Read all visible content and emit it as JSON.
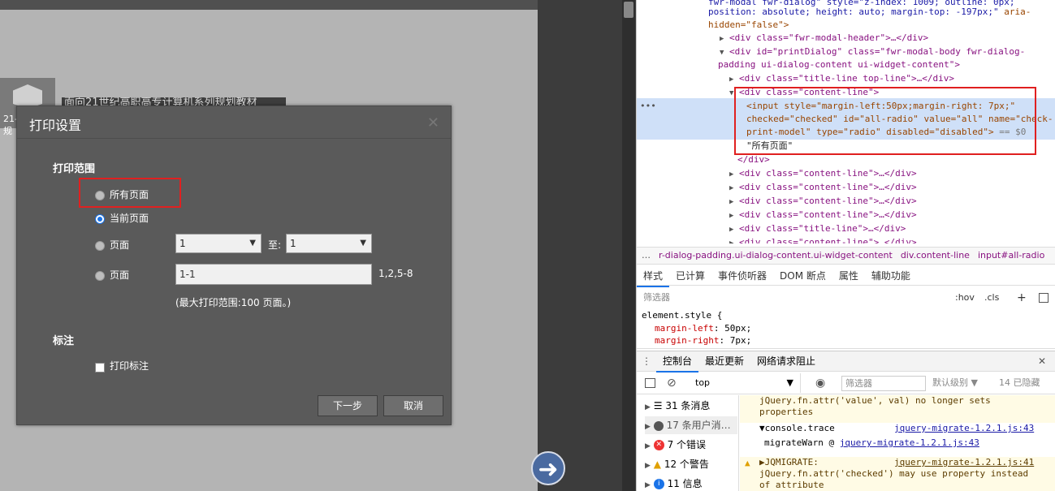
{
  "viewer": {
    "thumb_label": "21-",
    "thumb_label2": "规",
    "doc_title": "面向21世纪高职高专计算机系列规划教材",
    "back_icon": "arrow-left-icon"
  },
  "dialog": {
    "title": "打印设置",
    "close_icon": "close-icon",
    "range_section": "打印范围",
    "options": {
      "all_pages": "所有页面",
      "current_page": "当前页面",
      "page_range": "页面",
      "page_custom": "页面"
    },
    "from_value": "1",
    "to_label": "至:",
    "to_value": "1",
    "custom_value": "1-1",
    "custom_example": "1,2,5-8",
    "max_hint": "(最大打印范围:100 页面。)",
    "annot_section": "标注",
    "print_annot": "打印标注",
    "next_button": "下一步",
    "cancel_button": "取消"
  },
  "devtools": {
    "code_lines": {
      "l0": "fwr-modal fwr-dialog\" style=\"z-index: 1009; outline: 0px;",
      "l1a": "position: absolute; height: auto; margin-top: -197px;\"",
      "l1b": " aria-",
      "l2": "hidden=\"false\">",
      "l3": "<div class=\"fwr-modal-header\">…</div>",
      "l4": "<div id=\"printDialog\" class=\"fwr-modal-body fwr-dialog-",
      "l5": "padding ui-dialog-content ui-widget-content\">",
      "l6": "<div class=\"title-line top-line\">…</div>",
      "l7": "<div class=\"content-line\">",
      "l8": "<input style=\"margin-left:50px;margin-right: 7px;\"",
      "l9": "checked=\"checked\" id=\"all-radio\" value=\"all\" name=\"check-",
      "l10a": "print-model\" type=\"radio\" disabled=\"disabled\">",
      "l10b": " == $0",
      "l11": "\"所有页面\"",
      "l12": "</div>",
      "l13": "<div class=\"content-line\">…</div>",
      "l14": "<div class=\"content-line\">…</div>",
      "l15": "<div class=\"content-line\">…</div>",
      "l16": "<div class=\"content-line\">…</div>",
      "l17": "<div class=\"title-line\">…</div>",
      "l18": "<div class=\"content-line\">…</div>"
    },
    "breadcrumbs": [
      "…",
      "r-dialog-padding.ui-dialog-content.ui-widget-content",
      "div.content-line",
      "input#all-radio"
    ],
    "tabs": [
      "样式",
      "已计算",
      "事件侦听器",
      "DOM 断点",
      "属性",
      "辅助功能"
    ],
    "filter_placeholder": "筛选器",
    "hov": ":hov",
    "cls": ".cls",
    "plus": "+",
    "style_selector": "element.style {",
    "style_prop1": "margin-left",
    "style_val1": "50px;",
    "style_prop2": "margin-right",
    "style_val2": "7px;",
    "drawer_tabs": [
      "控制台",
      "最近更新",
      "网络请求阻止"
    ],
    "context": "top",
    "console_filter": "筛选器",
    "level": "默认级别 ▼",
    "hidden": "14 已隐藏",
    "sidebar": [
      {
        "icon": "list-icon",
        "label": "31 条消息"
      },
      {
        "icon": "user-icon",
        "label": "17 条用户消…"
      },
      {
        "icon": "error-icon",
        "label": "7 个错误"
      },
      {
        "icon": "warning-icon",
        "label": "12 个警告"
      },
      {
        "icon": "info-icon",
        "label": "11 信息"
      }
    ],
    "messages": {
      "m1a": "jQuery.fn.attr('value', val) no longer sets",
      "m1b": "properties",
      "m2": "▼console.trace",
      "m2link": "jquery-migrate-1.2.1.js:43",
      "m3": "migrateWarn @",
      "m3link": "jquery-migrate-1.2.1.js:43",
      "m4": "▶JQMIGRATE:",
      "m4link": "jquery-migrate-1.2.1.js:41",
      "m4b": "jQuery.fn.attr('checked') may use property instead",
      "m4c": "of attribute"
    }
  }
}
